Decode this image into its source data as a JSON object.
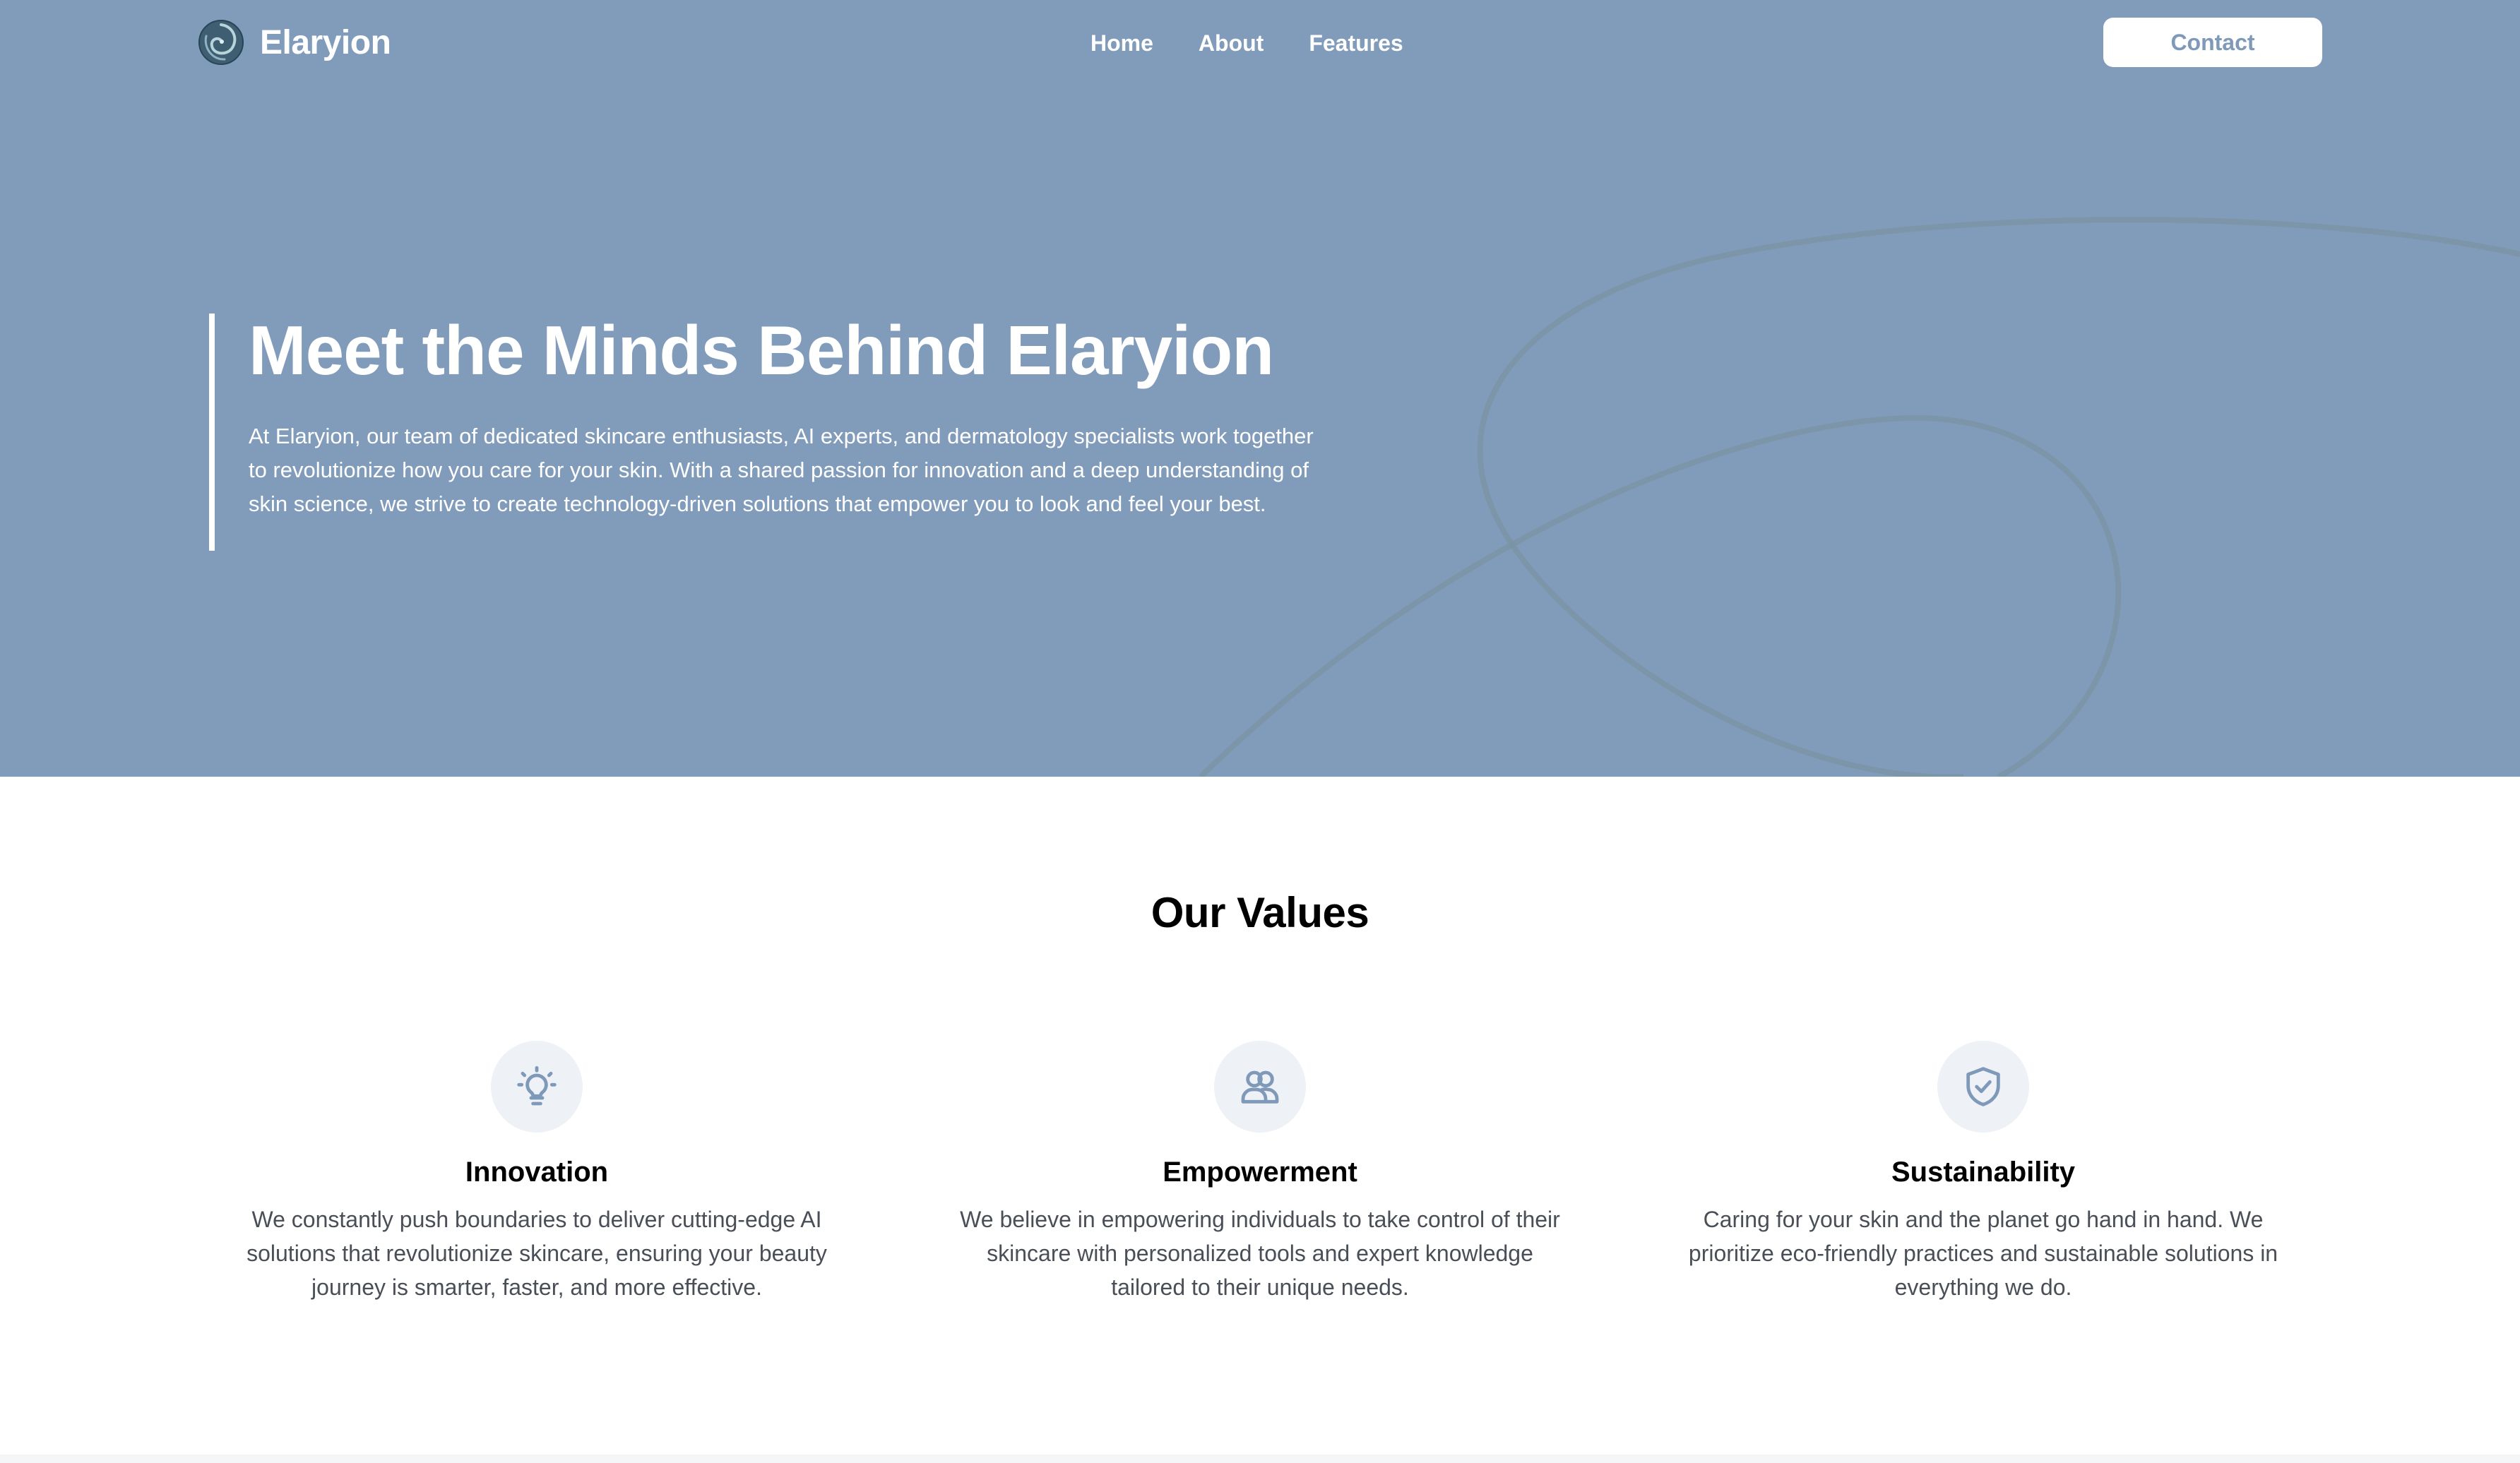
{
  "brand": {
    "name": "Elaryion",
    "logo_icon": "elaryion-logo-icon"
  },
  "nav": {
    "links": [
      {
        "label": "Home"
      },
      {
        "label": "About"
      },
      {
        "label": "Features"
      }
    ],
    "contact_label": "Contact"
  },
  "hero": {
    "title": "Meet the Minds Behind Elaryion",
    "text": "At Elaryion, our team of dedicated skincare enthusiasts, AI experts, and dermatology specialists work together to revolutionize how you care for your skin. With a shared passion for innovation and a deep understanding of skin science, we strive to create technology-driven solutions that empower you to look and feel your best."
  },
  "values": {
    "title": "Our Values",
    "items": [
      {
        "icon": "lightbulb-icon",
        "heading": "Innovation",
        "text": "We constantly push boundaries to deliver cutting-edge AI solutions that revolutionize skincare, ensuring your beauty journey is smarter, faster, and more effective."
      },
      {
        "icon": "users-icon",
        "heading": "Empowerment",
        "text": "We believe in empowering individuals to take control of their skincare with personalized tools and expert knowledge tailored to their unique needs."
      },
      {
        "icon": "shield-check-icon",
        "heading": "Sustainability",
        "text": "Caring for your skin and the planet go hand in hand. We prioritize eco-friendly practices and sustainable solutions in everything we do."
      }
    ]
  },
  "colors": {
    "hero_background": "#819cbb",
    "accent": "#7f99b9",
    "icon_background": "#eef1f5"
  }
}
